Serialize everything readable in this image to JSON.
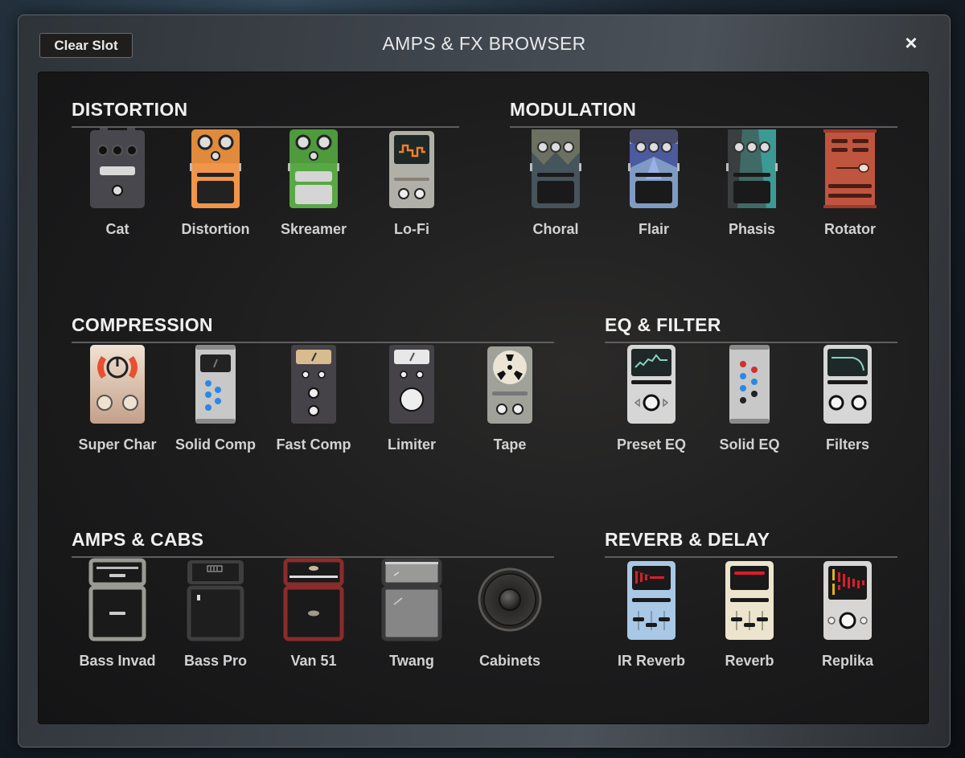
{
  "window": {
    "title": "AMPS & FX BROWSER",
    "clear_slot_label": "Clear Slot",
    "close_icon": "×"
  },
  "sections": {
    "distortion": {
      "title": "DISTORTION",
      "items": [
        {
          "label": "Cat",
          "icon": "cat-pedal-icon"
        },
        {
          "label": "Distortion",
          "icon": "distortion-pedal-icon"
        },
        {
          "label": "Skreamer",
          "icon": "skreamer-pedal-icon"
        },
        {
          "label": "Lo-Fi",
          "icon": "lofi-pedal-icon"
        }
      ]
    },
    "modulation": {
      "title": "MODULATION",
      "items": [
        {
          "label": "Choral",
          "icon": "choral-pedal-icon"
        },
        {
          "label": "Flair",
          "icon": "flair-pedal-icon"
        },
        {
          "label": "Phasis",
          "icon": "phasis-pedal-icon"
        },
        {
          "label": "Rotator",
          "icon": "rotator-icon"
        }
      ]
    },
    "compression": {
      "title": "COMPRESSION",
      "items": [
        {
          "label": "Super Char",
          "icon": "super-char-pedal-icon"
        },
        {
          "label": "Solid Comp",
          "icon": "solid-comp-icon"
        },
        {
          "label": "Fast Comp",
          "icon": "fast-comp-icon"
        },
        {
          "label": "Limiter",
          "icon": "limiter-icon"
        },
        {
          "label": "Tape",
          "icon": "tape-reel-icon"
        }
      ]
    },
    "eq_filter": {
      "title": "EQ & FILTER",
      "items": [
        {
          "label": "Preset EQ",
          "icon": "preset-eq-icon"
        },
        {
          "label": "Solid EQ",
          "icon": "solid-eq-icon"
        },
        {
          "label": "Filters",
          "icon": "filters-icon"
        }
      ]
    },
    "amps_cabs": {
      "title": "AMPS & CABS",
      "items": [
        {
          "label": "Bass Invad",
          "icon": "bass-invad-amp-icon"
        },
        {
          "label": "Bass Pro",
          "icon": "bass-pro-amp-icon"
        },
        {
          "label": "Van 51",
          "icon": "van51-amp-icon"
        },
        {
          "label": "Twang",
          "icon": "twang-amp-icon"
        },
        {
          "label": "Cabinets",
          "icon": "speaker-cabinet-icon"
        }
      ]
    },
    "reverb_delay": {
      "title": "REVERB & DELAY",
      "items": [
        {
          "label": "IR Reverb",
          "icon": "ir-reverb-icon"
        },
        {
          "label": "Reverb",
          "icon": "reverb-icon"
        },
        {
          "label": "Replika",
          "icon": "replika-icon"
        }
      ]
    }
  }
}
